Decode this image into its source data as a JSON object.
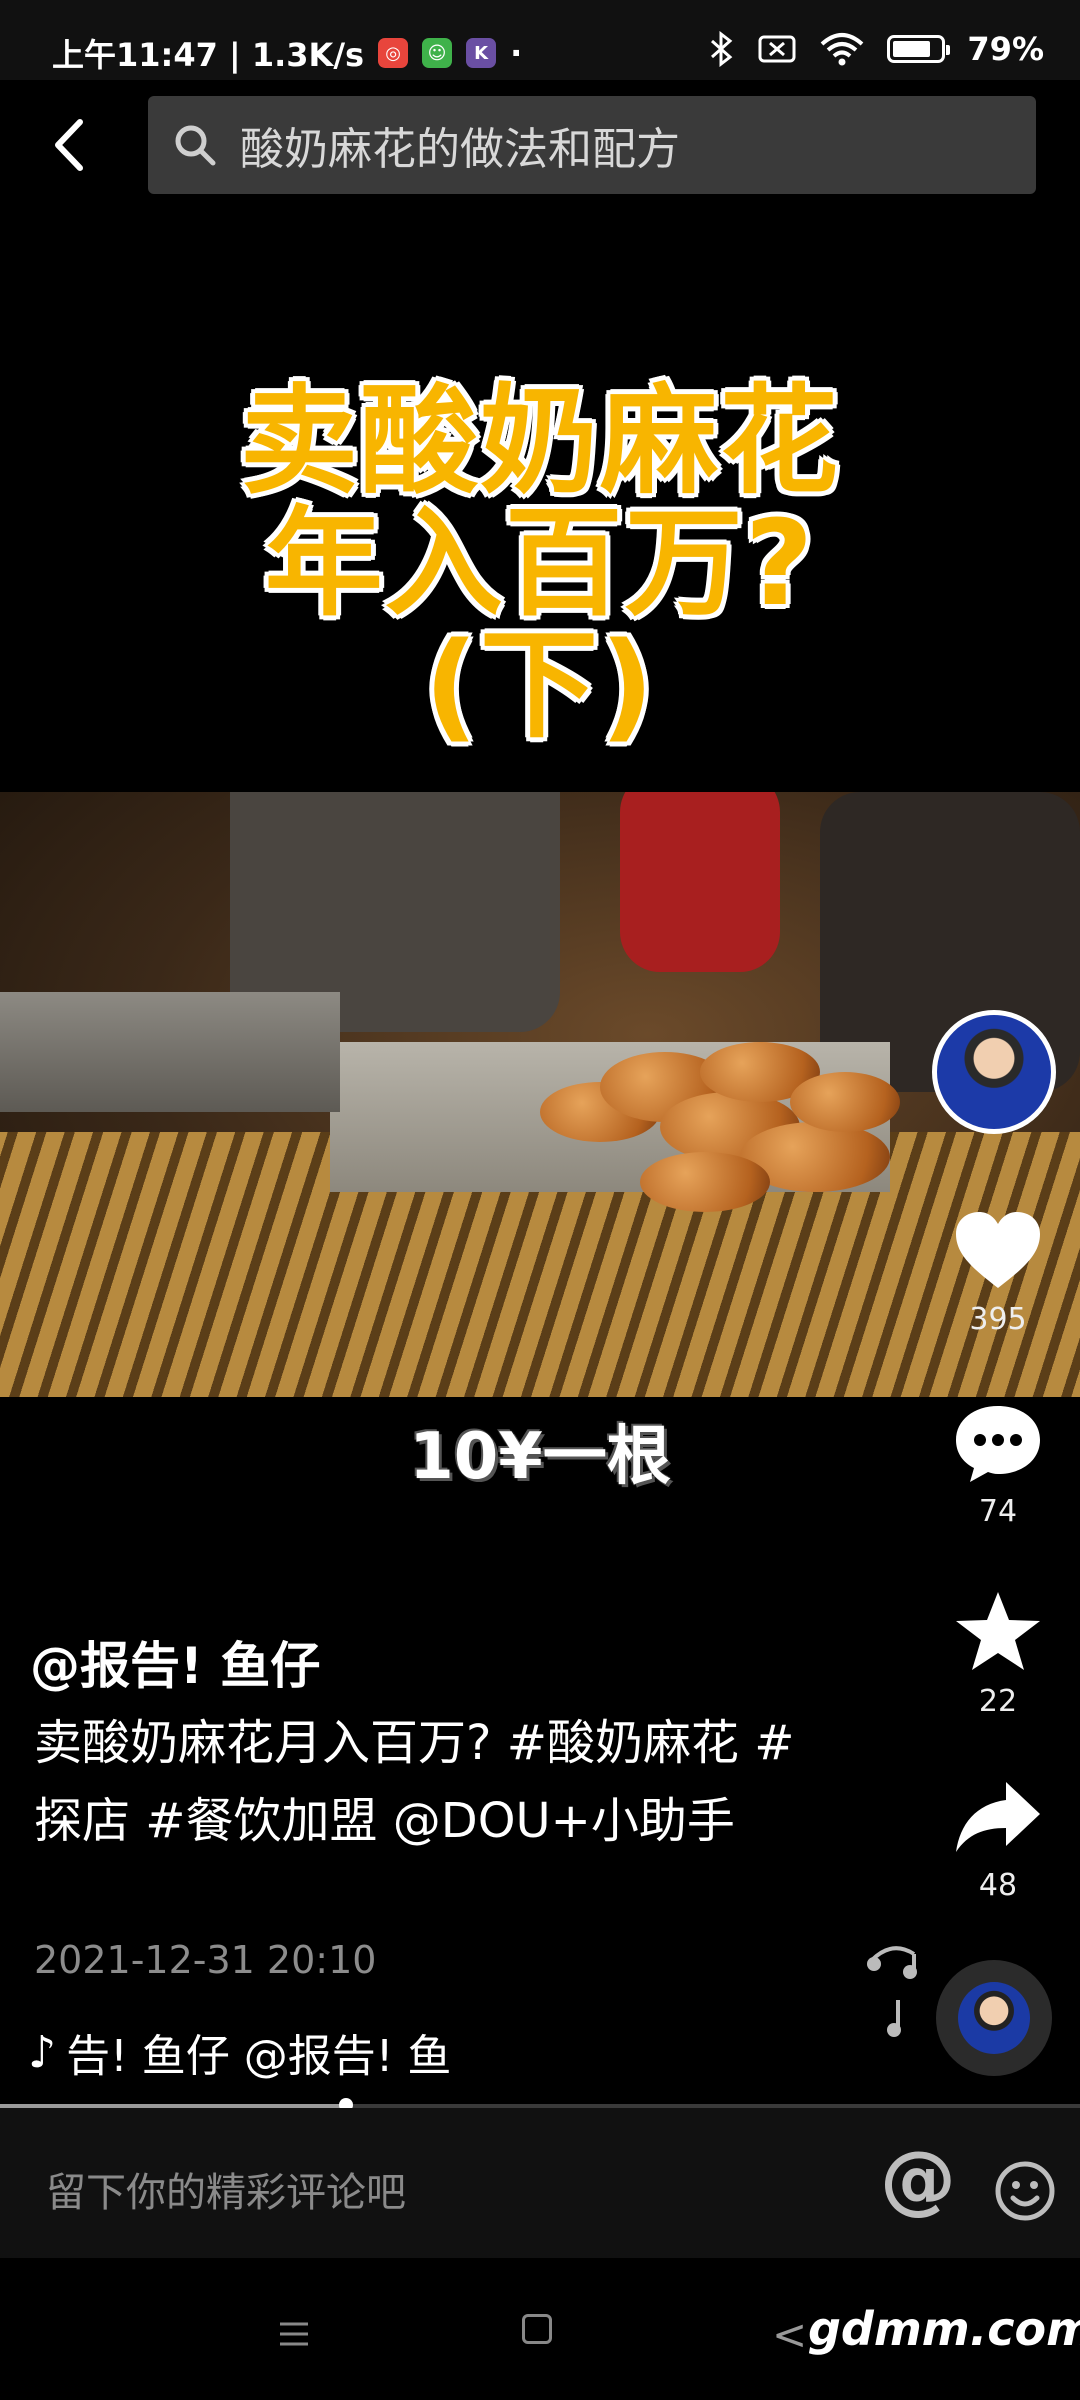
{
  "status_bar": {
    "time_network": "上午11:47 | 1.3K/s",
    "dot": "·",
    "battery_percent": "79%",
    "battery_level": 0.79
  },
  "search": {
    "query": "酸奶麻花的做法和配方"
  },
  "video": {
    "title_lines": [
      "卖酸奶麻花",
      "年入百万?",
      "(下)"
    ],
    "subtitle": "10¥一根"
  },
  "actions": {
    "likes": "395",
    "comments": "74",
    "favorites": "22",
    "shares": "48"
  },
  "post": {
    "author": "@报告! 鱼仔",
    "description": "卖酸奶麻花月入百万? #酸奶麻花 #探店 #餐饮加盟 @DOU+小助手",
    "date": "2021-12-31 20:10",
    "music": "告! 鱼仔    @报告! 鱼"
  },
  "progress": {
    "fraction": 0.32
  },
  "comment_bar": {
    "placeholder": "留下你的精彩评论吧",
    "at_symbol": "@"
  },
  "nav": {
    "back_glyph": "<",
    "watermark": "gdmm.com"
  },
  "colors": {
    "title_yellow": "#f8b500",
    "search_bg": "#3a3a3a"
  }
}
